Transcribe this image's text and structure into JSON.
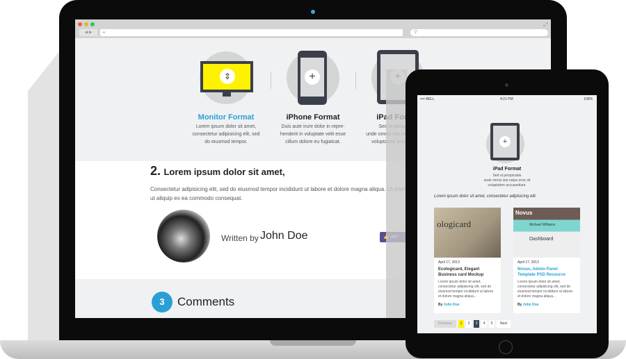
{
  "browser": {
    "address_placeholder": "+",
    "search_icon": "magnifier-icon"
  },
  "features": [
    {
      "title": "Monitor Format",
      "desc": [
        "Lorem ipsum dolor sit amet,",
        "consectetur adipisicing elit, sed",
        "do eiusmod tempor."
      ],
      "color": "#2a9fd6"
    },
    {
      "title": "iPhone Format",
      "desc": [
        "Duis aute irure dolor in repre-",
        "henderit in voluptate velit esse",
        "cillum dolore eu fugiatcat."
      ]
    },
    {
      "title": "iPad Format",
      "desc": [
        "Sed ut perspiciatis",
        "unde omnis iste natus error sit",
        "voluptatem accusantium."
      ]
    }
  ],
  "article": {
    "number": "2.",
    "heading": "Lorem ipsum dolor sit amet,",
    "body": "Consectetur adipisicing elit, sed do eiusmod tempor incididunt ut labore et dolore magna aliqua. Ut enim ad minim veniam, quis nostrud exercitation ullamco laboris nisi ut aliquip ex ea commodo consequat.",
    "written_by": "Written by",
    "author": "John Doe",
    "likes": "487"
  },
  "comments": {
    "count": "3",
    "label": "Comments"
  },
  "tablet": {
    "status": {
      "carrier": "BELL",
      "time": "4:21 PM",
      "battery": "100%"
    },
    "feature": {
      "title": "iPad Format",
      "desc": [
        "Sed ut perspiciatis",
        "unde omnis iste natus error sit",
        "voluptatem accusantium."
      ]
    },
    "intro": "Lorem ipsum dolor sit amet, consectetur adipisicing elit.",
    "cards": [
      {
        "image_text": "ologicard",
        "date": "April 17, 2013",
        "title": "Ecologicard, Elegant Business card Mockup",
        "excerpt": "Lorem ipsum dolor sit amet, consectetur adipisicing elit, sed do eiusmod tempor incididunt ut labore et dolore magna aliqua...",
        "by": "By",
        "author": "John Doe"
      },
      {
        "image_text": "Novus",
        "image_sub": "Dashboard",
        "image_user": "Michael Williams",
        "date": "April 17, 2013",
        "title": "Novus, Admin Panel Template PSD Resource",
        "excerpt": "Lorem ipsum dolor sit amet, consectetur adipisicing elit, sed do eiusmod tempor incididunt ut labore et dolore magna aliqua...",
        "by": "By",
        "author": "John Doe"
      }
    ],
    "pagination": {
      "previous": "Previous",
      "pages": [
        "1",
        "2",
        "3",
        "4",
        "5"
      ],
      "next": "Next"
    }
  }
}
